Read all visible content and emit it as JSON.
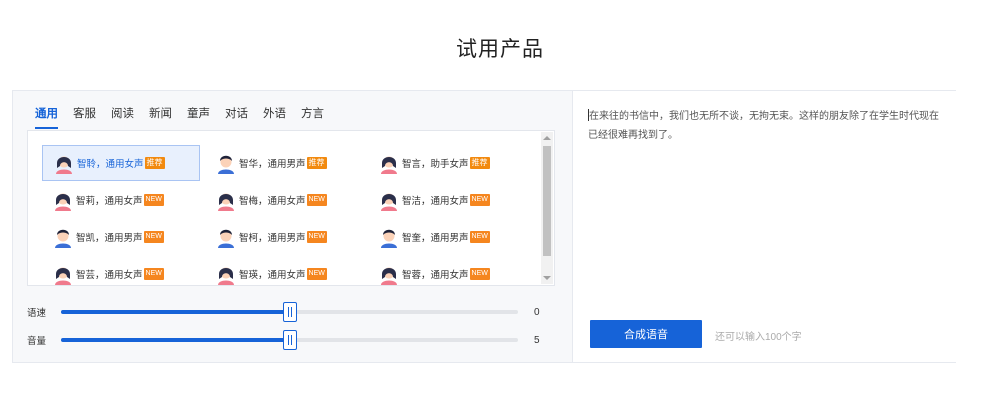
{
  "page": {
    "title": "试用产品"
  },
  "tabs": [
    {
      "label": "通用",
      "active": true
    },
    {
      "label": "客服",
      "active": false
    },
    {
      "label": "阅读",
      "active": false
    },
    {
      "label": "新闻",
      "active": false
    },
    {
      "label": "童声",
      "active": false
    },
    {
      "label": "对话",
      "active": false
    },
    {
      "label": "外语",
      "active": false
    },
    {
      "label": "方言",
      "active": false
    }
  ],
  "voices": [
    {
      "name": "智聆，通用女声",
      "badge": "推荐",
      "gender": "female",
      "selected": true
    },
    {
      "name": "智华，通用男声",
      "badge": "推荐",
      "gender": "male",
      "selected": false
    },
    {
      "name": "智言，助手女声",
      "badge": "推荐",
      "gender": "female",
      "selected": false
    },
    {
      "name": "智莉，通用女声",
      "badge": "NEW",
      "gender": "female",
      "selected": false
    },
    {
      "name": "智梅，通用女声",
      "badge": "NEW",
      "gender": "female",
      "selected": false
    },
    {
      "name": "智洁，通用女声",
      "badge": "NEW",
      "gender": "female",
      "selected": false
    },
    {
      "name": "智凯，通用男声",
      "badge": "NEW",
      "gender": "male",
      "selected": false
    },
    {
      "name": "智柯，通用男声",
      "badge": "NEW",
      "gender": "male",
      "selected": false
    },
    {
      "name": "智奎，通用男声",
      "badge": "NEW",
      "gender": "male",
      "selected": false
    },
    {
      "name": "智芸，通用女声",
      "badge": "NEW",
      "gender": "female",
      "selected": false
    },
    {
      "name": "智瑛，通用女声",
      "badge": "NEW",
      "gender": "female",
      "selected": false
    },
    {
      "name": "智蓉，通用女声",
      "badge": "NEW",
      "gender": "female",
      "selected": false
    }
  ],
  "sliders": {
    "speed": {
      "label": "语速",
      "value": "0",
      "level": 0.5
    },
    "volume": {
      "label": "音量",
      "value": "5",
      "level": 0.5
    }
  },
  "text_input": {
    "value": "在来往的书信中，我们也无所不谈，无拘无束。这样的朋友除了在学生时代现在已经很难再找到了。"
  },
  "synth_button": {
    "label": "合成语音"
  },
  "remaining_hint": "还可以输入100个字",
  "colors": {
    "accent": "#1663d8",
    "badge": "#f28a0f",
    "panel_bg": "#f7f8fa"
  }
}
